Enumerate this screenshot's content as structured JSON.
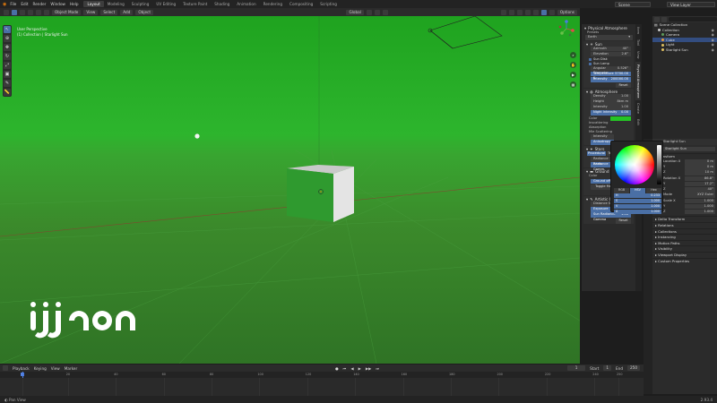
{
  "topbar": {
    "menus": [
      "File",
      "Edit",
      "Render",
      "Window",
      "Help"
    ],
    "workspaces": [
      "Layout",
      "Modeling",
      "Sculpting",
      "UV Editing",
      "Texture Paint",
      "Shading",
      "Animation",
      "Rendering",
      "Compositing",
      "Scripting"
    ],
    "active_workspace": "Layout",
    "scene": "Scene",
    "view_layer": "View Layer"
  },
  "header": {
    "mode": "Object Mode",
    "menus": [
      "View",
      "Select",
      "Add",
      "Object"
    ],
    "transform": "Global",
    "options": "Options"
  },
  "viewport": {
    "view_name": "User Perspective",
    "collection_info": "(1) Collection | Starlight Sun"
  },
  "npanel": {
    "title": "Physical Atmosphere",
    "presets_label": "Presets",
    "preset_value": "Earth",
    "sun": {
      "title": "Sun",
      "azimuth_label": "Azimuth",
      "azimuth": "40°",
      "elevation_label": "Elevation",
      "elevation": "2.6°",
      "sun_disk": "Sun Disk",
      "sun_lamp": "Sun Lamp",
      "angular_label": "Angular Diameter",
      "angular": "0.526°",
      "temperature_label": "Temperature K",
      "temperature": "5700.00",
      "intensity_label": "Intensity",
      "intensity": "200000.00",
      "reset": "Reset"
    },
    "atmosphere": {
      "title": "Atmosphere",
      "density_label": "Density",
      "density": "1.00",
      "height_label": "Height",
      "height": "8km m",
      "intensity_label": "Intensity",
      "intensity": "1.00",
      "night_label": "Night Intensity",
      "night": "0.00",
      "color_label": "Color",
      "incl_label": "Inscattering",
      "absorption_label": "Absorption",
      "mie_label": "Mie Scattering",
      "mie_int": "Intensity",
      "mie_anis": "Anisotropy"
    },
    "stars": {
      "title": "Stars",
      "tabs": [
        "Procedural",
        "Texture"
      ],
      "radiance_label": "Radiance Inten.",
      "gamma_label": "Radiance Gamm."
    },
    "ground": {
      "title": "Ground",
      "color_label": "Color",
      "offset_label": "Ground offset",
      "toggle": "Toggle Material Fog",
      "reset": "Reset"
    },
    "artistic": {
      "title": "Artistic Controls",
      "scale_label": "Distance Scale",
      "scale": "1.00",
      "exposure_label": "Exposure",
      "exposure": "1.00",
      "gamma_label": "Sun Radiance Gamma",
      "gamma": "1.00",
      "reset": "Reset"
    },
    "tabs": [
      "Item",
      "Tool",
      "View",
      "Physical Atmosphere",
      "Create",
      "Edit"
    ]
  },
  "picker": {
    "modes": [
      "RGB",
      "HSV",
      "Hex"
    ],
    "active_mode": "HSV",
    "rows": [
      {
        "k": "H",
        "v": "0.233"
      },
      {
        "k": "S",
        "v": "1.000"
      },
      {
        "k": "V",
        "v": "1.000"
      },
      {
        "k": "A",
        "v": "1.000"
      }
    ]
  },
  "outliner": {
    "title": "Scene Collection",
    "items": [
      {
        "name": "Collection",
        "color": "#cccccc",
        "indent": 1
      },
      {
        "name": "Camera",
        "color": "#5e9c5c",
        "indent": 2
      },
      {
        "name": "Cube",
        "color": "#e69a3c",
        "indent": 2
      },
      {
        "name": "Light",
        "color": "#e0c060",
        "indent": 2
      },
      {
        "name": "Starlight Sun",
        "color": "#e0c060",
        "indent": 2
      }
    ],
    "selected_index": 2
  },
  "properties": {
    "object_name": "Starlight Sun",
    "header": "Starlight Sun",
    "section_transform": "Transform",
    "location": [
      {
        "k": "Location X",
        "v": "0 m"
      },
      {
        "k": "Y",
        "v": "0 m"
      },
      {
        "k": "Z",
        "v": "10 m"
      }
    ],
    "rotation": [
      {
        "k": "Rotation X",
        "v": "86.8°"
      },
      {
        "k": "Y",
        "v": "17.2°"
      },
      {
        "k": "Z",
        "v": "40°"
      }
    ],
    "mode_label": "Mode",
    "mode": "XYZ Euler",
    "scale": [
      {
        "k": "Scale X",
        "v": "1.000"
      },
      {
        "k": "Y",
        "v": "1.000"
      },
      {
        "k": "Z",
        "v": "1.000"
      }
    ],
    "sections": [
      "Delta Transform",
      "Relations",
      "Collections",
      "Instancing",
      "Motion Paths",
      "Visibility",
      "Viewport Display",
      "Custom Properties"
    ]
  },
  "timeline": {
    "menus": [
      "Playback",
      "Keying",
      "View",
      "Marker"
    ],
    "current_frame": "1",
    "start_label": "Start",
    "start": "1",
    "end_label": "End",
    "end": "250",
    "ticks": [
      "1",
      "20",
      "40",
      "60",
      "80",
      "100",
      "120",
      "140",
      "160",
      "180",
      "200",
      "220",
      "240",
      "250"
    ]
  },
  "status": {
    "left": "Pan View",
    "right": "2.93.4"
  },
  "logo": {
    "text": "ijigen"
  },
  "colors": {
    "accent": "#4a6fa5",
    "atmo_color": "#25c425",
    "ground_color": "#8ad82a"
  }
}
